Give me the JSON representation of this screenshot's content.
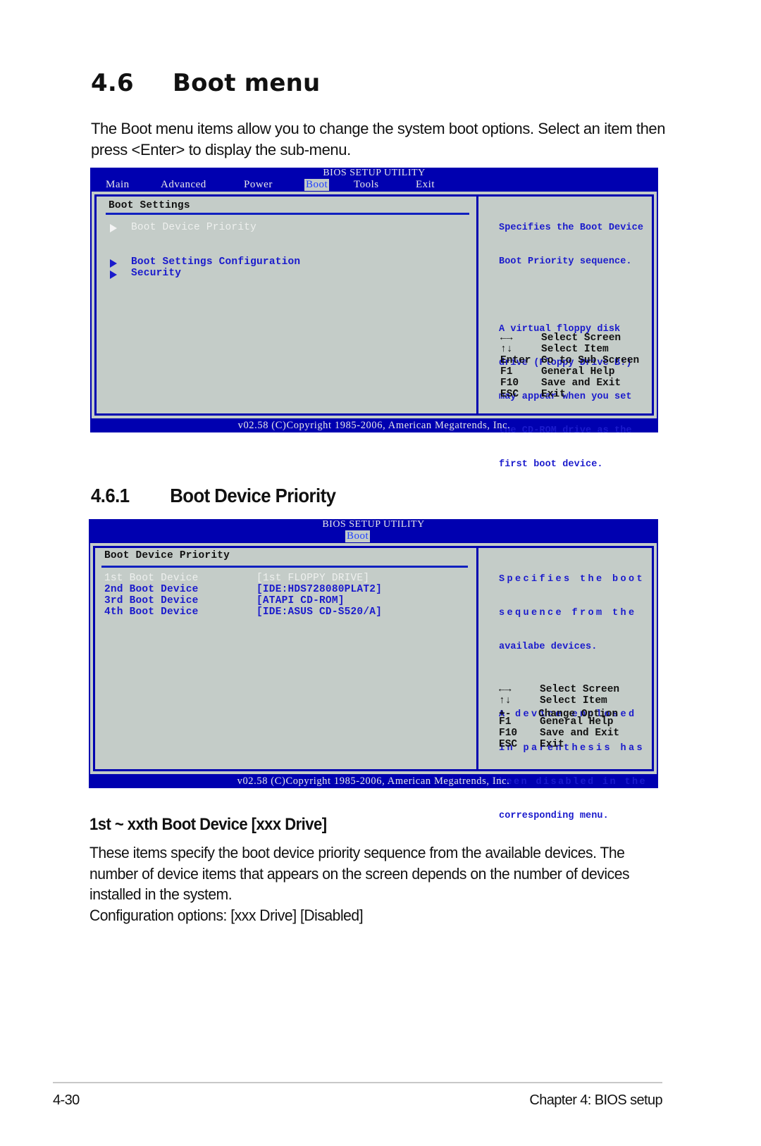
{
  "section": {
    "number": "4.6",
    "title": "Boot menu",
    "intro": "The Boot menu items allow you to change the system boot options. Select an item then press <Enter> to display the sub-menu."
  },
  "bios_main": {
    "title": "BIOS SETUP UTILITY",
    "tabs": [
      "Main",
      "Advanced",
      "Power",
      "Boot",
      "Tools",
      "Exit"
    ],
    "active_tab": "Boot",
    "panel_title": "Boot Settings",
    "items": [
      {
        "label": "Boot Device Priority",
        "selected": true
      },
      {
        "label": "Boot Settings Configuration",
        "selected": false
      },
      {
        "label": "Security",
        "selected": false
      }
    ],
    "help": {
      "line1": "Specifies the Boot Device",
      "line2": "Boot Priority sequence.",
      "p2": [
        "A virtual floppy disk",
        "drive (Floppy Drive B:)",
        "may appear when you set",
        "the CD-ROM drive as the",
        "first boot device."
      ]
    },
    "keys": [
      {
        "key": "left-right-arrows",
        "desc": "Select Screen"
      },
      {
        "key": "up-down-arrows",
        "desc": "Select Item"
      },
      {
        "key": "Enter",
        "desc": "Go to Sub Screen"
      },
      {
        "key": "F1",
        "desc": "General Help"
      },
      {
        "key": "F10",
        "desc": "Save and Exit"
      },
      {
        "key": "ESC",
        "desc": "Exit"
      }
    ],
    "copyright": "v02.58 (C)Copyright 1985-2006, American Megatrends, Inc."
  },
  "subsection": {
    "number": "4.6.1",
    "title": "Boot Device Priority"
  },
  "bios_priority": {
    "title": "BIOS SETUP UTILITY",
    "active_tab": "Boot",
    "panel_title": "Boot Device Priority",
    "devices": [
      {
        "label": "1st Boot Device",
        "value": "[1st FLOPPY DRIVE]",
        "selected": true
      },
      {
        "label": "2nd Boot Device",
        "value": "[IDE:HDS728080PLAT2]",
        "selected": false
      },
      {
        "label": "3rd Boot Device",
        "value": "[ATAPI CD-ROM]",
        "selected": false
      },
      {
        "label": "4th Boot Device",
        "value": "[IDE:ASUS CD-S520/A]",
        "selected": false
      }
    ],
    "help": {
      "p1": [
        "Specifies the boot",
        "sequence from the",
        "availabe devices."
      ],
      "p2": [
        "A device enclosed",
        "in parenthesis has",
        "been disabled in the",
        "corresponding menu."
      ]
    },
    "keys": [
      {
        "key": "left-right-arrows",
        "desc": "Select Screen"
      },
      {
        "key": "up-down-arrows",
        "desc": "Select Item"
      },
      {
        "key": "+-",
        "desc": "Change Option"
      },
      {
        "key": "F1",
        "desc": "General Help"
      },
      {
        "key": "F10",
        "desc": "Save and Exit"
      },
      {
        "key": "ESC",
        "desc": "Exit"
      }
    ],
    "copyright": "v02.58 (C)Copyright 1985-2006, American Megatrends, Inc."
  },
  "item_desc": {
    "title": "1st ~ xxth Boot Device [xxx Drive]",
    "paragraph": "These items specify the boot device priority sequence from the available devices. The number of device items that appears on the screen depends on the number of devices installed in the system.",
    "config": "Configuration options: [xxx Drive] [Disabled]"
  },
  "footer": {
    "page": "4-30",
    "chapter": "Chapter 4: BIOS setup"
  }
}
